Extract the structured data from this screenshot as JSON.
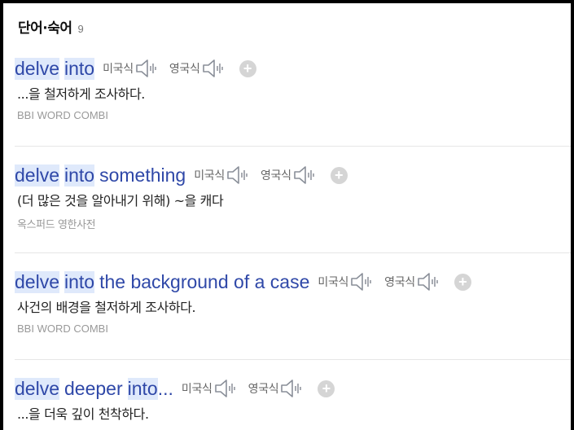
{
  "header": {
    "title": "단어·숙어",
    "count": "9"
  },
  "pron": {
    "us_label": "미국식",
    "uk_label": "영국식",
    "add_symbol": "+"
  },
  "entries": [
    {
      "term_parts": [
        {
          "text": "delve",
          "hl": true
        },
        {
          "text": "into",
          "hl": true
        }
      ],
      "meaning": "...을 철저하게 조사하다.",
      "source": "BBI WORD COMBI"
    },
    {
      "term_parts": [
        {
          "text": "delve",
          "hl": true
        },
        {
          "text": "into",
          "hl": true
        },
        {
          "text": "something",
          "hl": false
        }
      ],
      "meaning": "(더 많은 것을 알아내기 위해) ~을 캐다",
      "source": "옥스퍼드 영한사전"
    },
    {
      "term_parts": [
        {
          "text": "delve",
          "hl": true
        },
        {
          "text": "into",
          "hl": true
        },
        {
          "text": "the background of a case",
          "hl": false
        }
      ],
      "meaning": "사건의 배경을 철저하게 조사하다.",
      "source": "BBI WORD COMBI"
    },
    {
      "term_parts": [
        {
          "text": "delve",
          "hl": true
        },
        {
          "text": "deeper",
          "hl": false
        },
        {
          "text": "into",
          "hl": true
        },
        {
          "text": "...",
          "hl": false
        }
      ],
      "meaning": "...을 더욱 깊이 천착하다.",
      "source": ""
    }
  ]
}
